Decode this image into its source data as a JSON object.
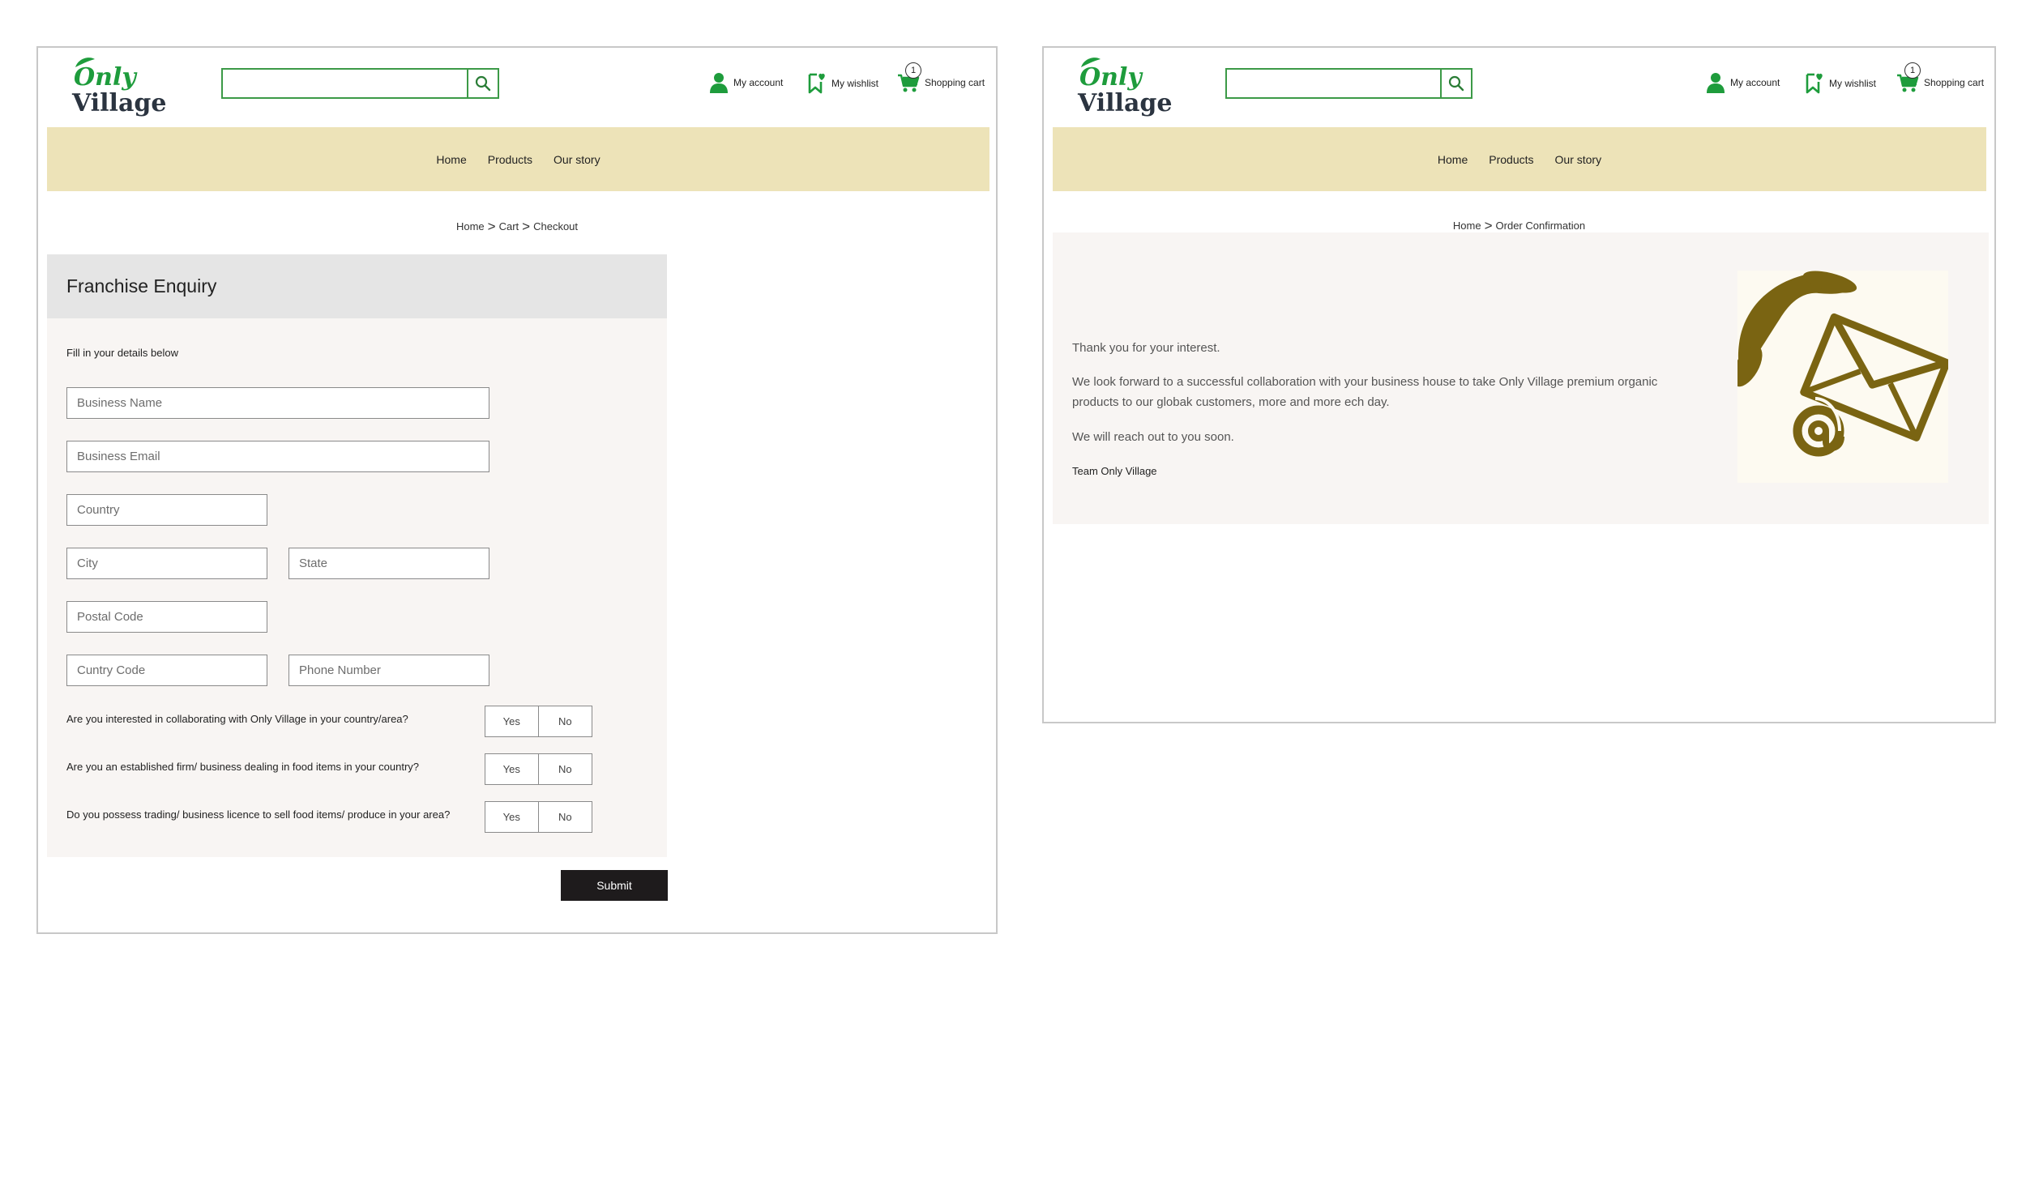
{
  "brand": {
    "line1": "Only",
    "line2": "Village"
  },
  "colors": {
    "brand_green": "#1e9c3c",
    "nav_bg": "#ede3b8",
    "border_green": "#3c9a47",
    "olive": "#7a6412",
    "dark": "#1e1b1c"
  },
  "icons": {
    "search": "search-icon",
    "account": "user-icon",
    "wishlist": "bookmark-heart-icon",
    "cart": "cart-icon"
  },
  "header": {
    "search_placeholder": "",
    "account_label": "My account",
    "wishlist_label": "My wishlist",
    "cart_label": "Shopping cart",
    "cart_count": "1"
  },
  "nav": {
    "home": "Home",
    "products": "Products",
    "story": "Our story"
  },
  "enquiry_page": {
    "breadcrumb": [
      "Home",
      "Cart",
      "Checkout"
    ],
    "title": "Franchise Enquiry",
    "subtitle": "Fill in your details below",
    "placeholders": {
      "business_name": "Business Name",
      "business_email": "Business Email",
      "country": "Country",
      "city": "City",
      "state": "State",
      "postal_code": "Postal Code",
      "country_code": "Cuntry Code",
      "phone_number": "Phone Number"
    },
    "questions": [
      "Are you interested in collaborating with Only Village in your country/area?",
      "Are you an established firm/ business dealing in food items in your country?",
      "Do you possess trading/ business licence to sell food items/ produce in your area?"
    ],
    "yes_label": "Yes",
    "no_label": "No",
    "submit_label": "Submit"
  },
  "confirmation_page": {
    "breadcrumb": [
      "Home",
      "Order Confirmation"
    ],
    "thanks": "Thank you for your interest.",
    "body_line1": "We look forward to a successful collaboration with your business house to take Only Village premium organic",
    "body_line2": "products to our globak customers, more and more ech day.",
    "reach": "We will reach out to you soon.",
    "signature": "Team Only Village"
  }
}
